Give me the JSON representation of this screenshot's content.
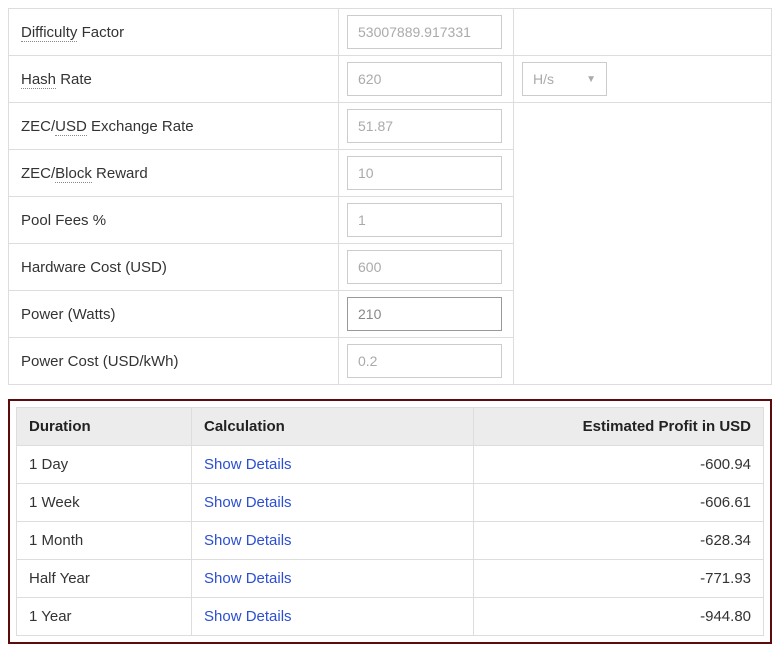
{
  "form": {
    "rows": [
      {
        "label_pre": "",
        "label_dot": "Difficulty",
        "label_post": " Factor",
        "value": "53007889.917331",
        "has_select": false,
        "active": false
      },
      {
        "label_pre": "",
        "label_dot": "Hash",
        "label_post": " Rate",
        "value": "620",
        "has_select": true,
        "select_value": "H/s",
        "active": false
      },
      {
        "label_pre": "ZEC/",
        "label_dot": "USD",
        "label_post": " Exchange Rate",
        "value": "51.87",
        "has_select": false,
        "active": false
      },
      {
        "label_pre": "ZEC/",
        "label_dot": "Block",
        "label_post": " Reward",
        "value": "10",
        "has_select": false,
        "active": false
      },
      {
        "label_pre": "",
        "label_dot": "",
        "label_post": "Pool Fees %",
        "value": "1",
        "has_select": false,
        "active": false
      },
      {
        "label_pre": "",
        "label_dot": "",
        "label_post": "Hardware Cost (USD)",
        "value": "600",
        "has_select": false,
        "active": false
      },
      {
        "label_pre": "",
        "label_dot": "",
        "label_post": "Power (Watts)",
        "value": "210",
        "has_select": false,
        "active": true
      },
      {
        "label_pre": "",
        "label_dot": "",
        "label_post": "Power Cost (USD/kWh)",
        "value": "0.2",
        "has_select": false,
        "active": false
      }
    ]
  },
  "results": {
    "headers": {
      "duration": "Duration",
      "calculation": "Calculation",
      "profit": "Estimated Profit in USD"
    },
    "details_label": "Show Details",
    "rows": [
      {
        "duration": "1 Day",
        "profit": "-600.94"
      },
      {
        "duration": "1 Week",
        "profit": "-606.61"
      },
      {
        "duration": "1 Month",
        "profit": "-628.34"
      },
      {
        "duration": "Half Year",
        "profit": "-771.93"
      },
      {
        "duration": "1 Year",
        "profit": "-944.80"
      }
    ]
  }
}
